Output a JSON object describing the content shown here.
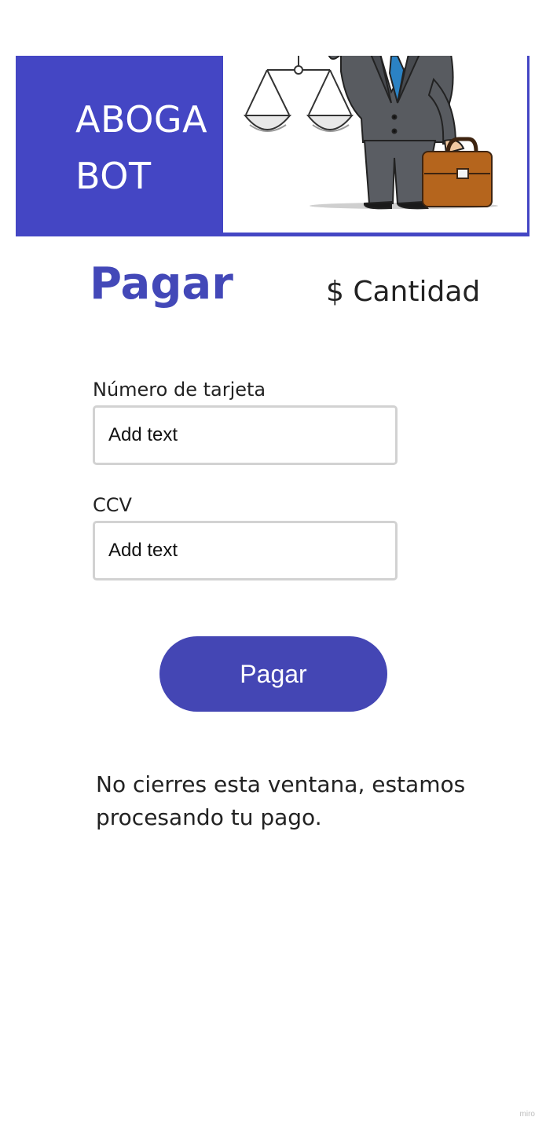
{
  "banner": {
    "brand_line_1": "ABOGA",
    "brand_line_2": "BOT",
    "illustration": "lawyer-with-scales-and-briefcase",
    "brand_color": "#4446c4"
  },
  "payment": {
    "title": "Pagar",
    "amount_label": "$ Cantidad",
    "card_number_label": "Número de tarjeta",
    "card_number_placeholder": "Add text",
    "ccv_label": "CCV",
    "ccv_placeholder": "Add text",
    "submit_label": "Pagar",
    "accent_color": "#4446b4"
  },
  "notice": {
    "text": "No cierres esta ventana, estamos procesando tu pago."
  },
  "watermark": {
    "text": "miro"
  }
}
